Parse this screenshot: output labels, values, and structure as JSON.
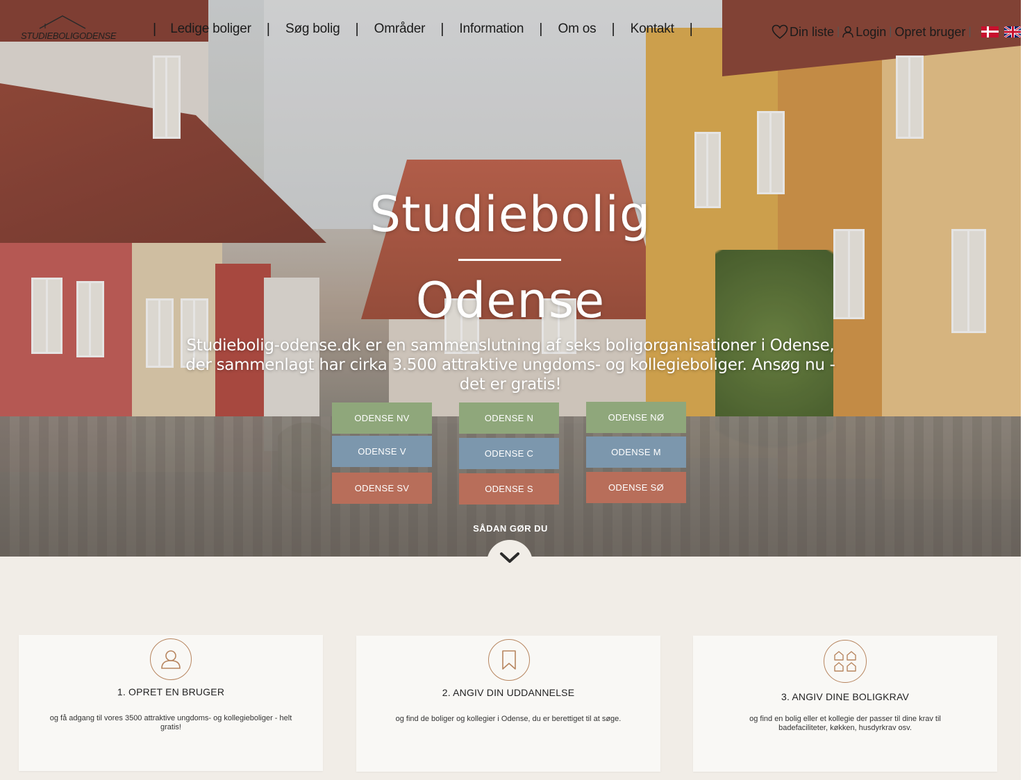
{
  "brand": {
    "logo_text": "STUDIEBOLIGODENSE"
  },
  "nav": {
    "items": [
      "Ledige boliger",
      "Søg bolig",
      "Områder",
      "Information",
      "Om os",
      "Kontakt"
    ],
    "separator": "|"
  },
  "util": {
    "wishlist": "Din liste",
    "login": "Login",
    "register": "Opret bruger",
    "separator": "|",
    "flags": [
      "flag-dk-icon",
      "flag-uk-icon"
    ]
  },
  "hero": {
    "title_line1": "Studiebolig",
    "title_line2": "Odense",
    "description": "Studiebolig-odense.dk er en sammenslutning af seks boligorganisationer i Odense, der sammenlagt har cirka 3.500 attraktive ungdoms- og kollegieboliger. Ansøg nu - det er gratis!",
    "how_label": "SÅDAN GØR DU"
  },
  "areas": {
    "col1": [
      "ODENSE NV",
      "ODENSE V",
      "ODENSE SV"
    ],
    "col2": [
      "ODENSE N",
      "ODENSE C",
      "ODENSE S"
    ],
    "col3": [
      "ODENSE NØ",
      "ODENSE M",
      "ODENSE SØ"
    ]
  },
  "colors": {
    "green": "#8fa77b",
    "blue": "#7c97ad",
    "red": "#b86e5a",
    "accent": "#b7855f",
    "background": "#f1ede7"
  },
  "steps": [
    {
      "icon": "user-icon",
      "title": "1. OPRET EN BRUGER",
      "text": "og få adgang til vores 3500 attraktive ungdoms- og kollegieboliger - helt gratis!"
    },
    {
      "icon": "bookmark-icon",
      "title": "2. ANGIV DIN UDDANNELSE",
      "text": "og find de boliger og kollegier i Odense, du er berettiget til at søge."
    },
    {
      "icon": "houses-icon",
      "title": "3. ANGIV DINE BOLIGKRAV",
      "text": "og find en bolig eller et kollegie der passer til dine krav til badefaciliteter, køkken, husdyrkrav osv."
    }
  ]
}
